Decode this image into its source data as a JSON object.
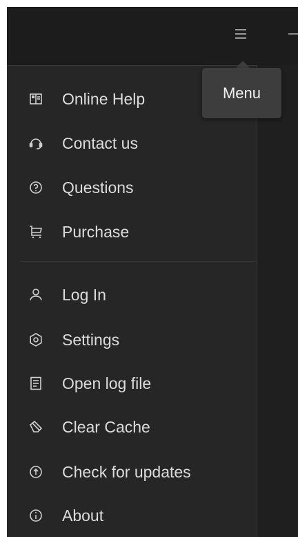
{
  "tooltip": {
    "text": "Menu"
  },
  "titlebar": {
    "menu_icon": "hamburger-icon",
    "minimize_icon": "minimize-icon"
  },
  "menu": {
    "items": [
      {
        "label": "Online Help",
        "icon": "book-icon"
      },
      {
        "label": "Contact us",
        "icon": "headset-icon"
      },
      {
        "label": "Questions",
        "icon": "question-circle-icon"
      },
      {
        "label": "Purchase",
        "icon": "cart-icon"
      },
      {
        "label": "Log In",
        "icon": "user-icon"
      },
      {
        "label": "Settings",
        "icon": "gear-icon"
      },
      {
        "label": "Open log file",
        "icon": "document-icon"
      },
      {
        "label": "Clear Cache",
        "icon": "eraser-icon"
      },
      {
        "label": "Check for updates",
        "icon": "arrow-up-circle-icon"
      },
      {
        "label": "About",
        "icon": "info-circle-icon"
      }
    ]
  },
  "colors": {
    "background": "#1f1f1f",
    "menu_background": "#262626",
    "text": "#dcdcdc",
    "icon": "#cfcfcf",
    "tooltip_background": "#3d3d3d"
  }
}
